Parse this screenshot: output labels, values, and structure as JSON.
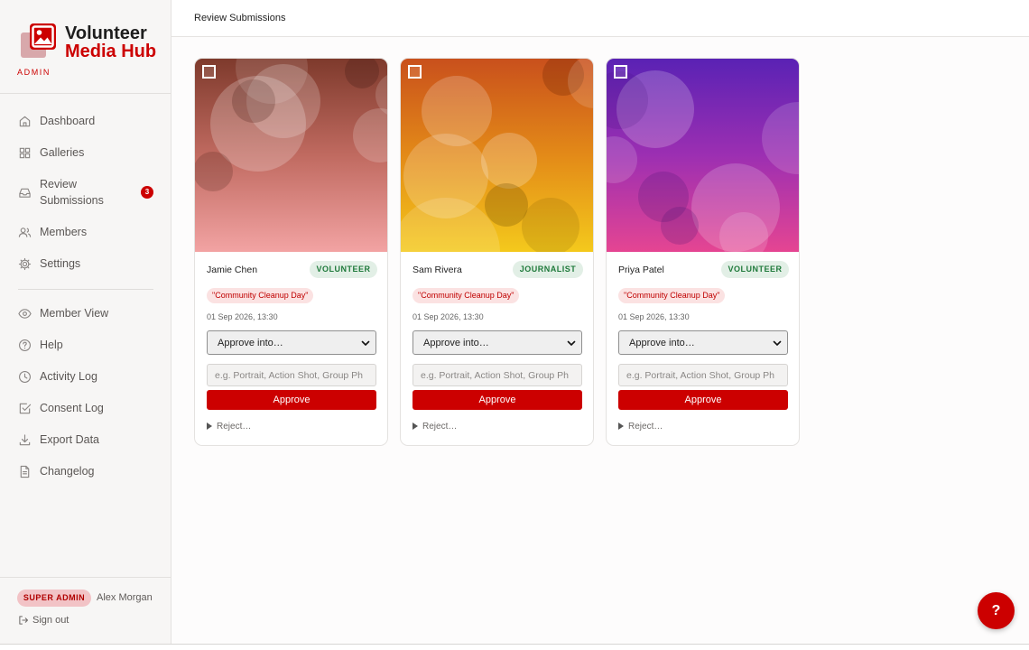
{
  "brand": {
    "name": "Volunteer",
    "sub": "Media Hub",
    "role": "ADMIN"
  },
  "accent_color": "#cc0000",
  "nav": {
    "items": [
      {
        "label": "Dashboard",
        "icon": "home-icon"
      },
      {
        "label": "Galleries",
        "icon": "grid-icon"
      },
      {
        "label": "Review Submissions",
        "icon": "inbox-icon",
        "badge": "3"
      },
      {
        "label": "Members",
        "icon": "users-icon"
      },
      {
        "label": "Settings",
        "icon": "gear-icon"
      },
      {
        "label": "Member View",
        "icon": "eye-icon"
      },
      {
        "label": "Help",
        "icon": "help-circle-icon"
      },
      {
        "label": "Activity Log",
        "icon": "clock-icon"
      },
      {
        "label": "Consent Log",
        "icon": "check-square-icon"
      },
      {
        "label": "Export Data",
        "icon": "download-icon"
      },
      {
        "label": "Changelog",
        "icon": "file-text-icon"
      }
    ]
  },
  "user": {
    "role_badge": "SUPER ADMIN",
    "name": "Alex Morgan",
    "signout_label": "Sign out"
  },
  "header": {
    "title": "Review Submissions"
  },
  "submissions": [
    {
      "name": "Jamie Chen",
      "role": "VOLUNTEER",
      "event": "\"Community Cleanup Day\"",
      "date": "01 Sep 2026, 13:30",
      "select_value": "Approve into…",
      "tag_placeholder": "e.g. Portrait, Action Shot, Group Ph",
      "approve_label": "Approve",
      "reject_label": "Reject…"
    },
    {
      "name": "Sam Rivera",
      "role": "JOURNALIST",
      "event": "\"Community Cleanup Day\"",
      "date": "01 Sep 2026, 13:30",
      "select_value": "Approve into…",
      "tag_placeholder": "e.g. Portrait, Action Shot, Group Ph",
      "approve_label": "Approve",
      "reject_label": "Reject…"
    },
    {
      "name": "Priya Patel",
      "role": "VOLUNTEER",
      "event": "\"Community Cleanup Day\"",
      "date": "01 Sep 2026, 13:30",
      "select_value": "Approve into…",
      "tag_placeholder": "e.g. Portrait, Action Shot, Group Ph",
      "approve_label": "Approve",
      "reject_label": "Reject…"
    }
  ],
  "help_fab": {
    "label": "?"
  }
}
